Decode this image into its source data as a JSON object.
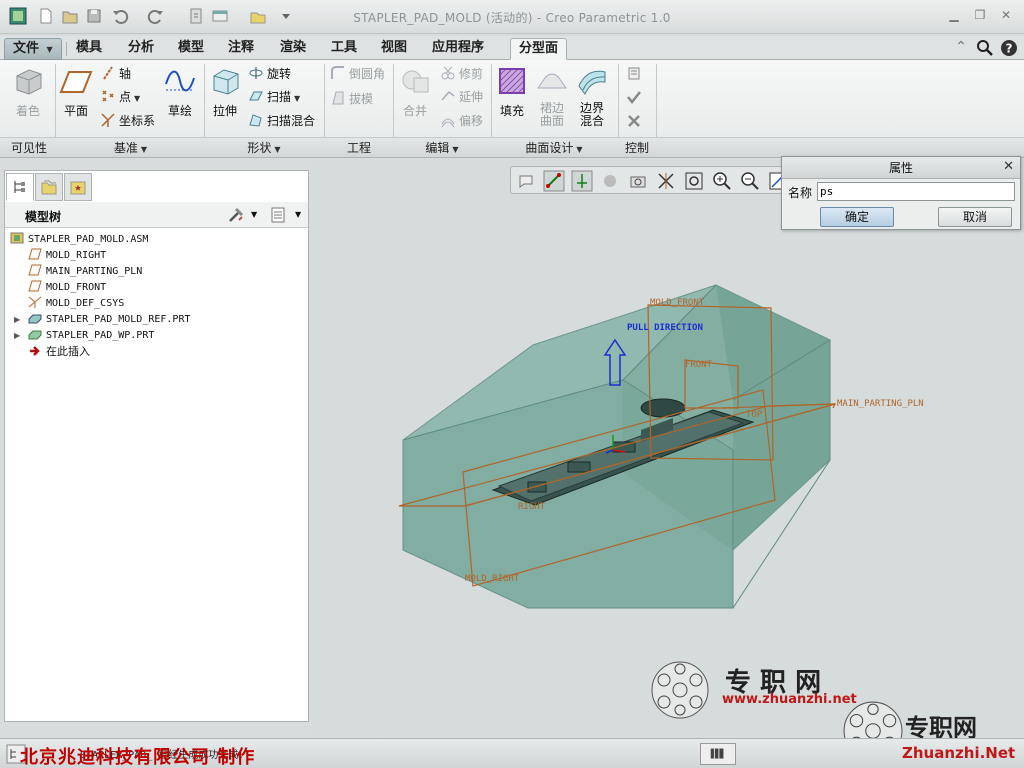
{
  "window": {
    "title": "STAPLER_PAD_MOLD (活动的) - Creo Parametric 1.0"
  },
  "tabs": [
    {
      "label": "文件",
      "name": "file"
    },
    {
      "label": "模具",
      "name": "mold"
    },
    {
      "label": "分析",
      "name": "analysis"
    },
    {
      "label": "模型",
      "name": "model"
    },
    {
      "label": "注释",
      "name": "annotate"
    },
    {
      "label": "渲染",
      "name": "render"
    },
    {
      "label": "工具",
      "name": "tools"
    },
    {
      "label": "视图",
      "name": "view"
    },
    {
      "label": "应用程序",
      "name": "applications"
    },
    {
      "label": "分型面",
      "name": "parting-surface"
    }
  ],
  "ribbon": {
    "visibility": {
      "shade": "着色",
      "group": "可见性"
    },
    "datum": {
      "plane": "平面",
      "axis": "轴",
      "point": "点",
      "csys": "坐标系",
      "sketch": "草绘",
      "group": "基准"
    },
    "shapes": {
      "extrude": "拉伸",
      "revolve": "旋转",
      "sweep": "扫描",
      "swept_blend": "扫描混合",
      "group": "形状"
    },
    "engineering": {
      "round": "倒圆角",
      "draft": "拔模",
      "group": "工程"
    },
    "editing": {
      "merge": "合并",
      "trim": "修剪",
      "extend": "延伸",
      "offset": "偏移",
      "group": "编辑"
    },
    "surface_design": {
      "fill": "填充",
      "skirt_1": "裙边",
      "skirt_2": "曲面",
      "boundary_1": "边界",
      "boundary_2": "混合",
      "group": "曲面设计"
    },
    "control": {
      "group": "控制"
    }
  },
  "model_tree": {
    "title": "模型树",
    "items": [
      {
        "label": "STAPLER_PAD_MOLD.ASM",
        "icon": "assembly-icon"
      },
      {
        "label": "MOLD_RIGHT",
        "icon": "datum-plane-icon"
      },
      {
        "label": "MAIN_PARTING_PLN",
        "icon": "datum-plane-icon"
      },
      {
        "label": "MOLD_FRONT",
        "icon": "datum-plane-icon"
      },
      {
        "label": "MOLD_DEF_CSYS",
        "icon": "csys-icon"
      },
      {
        "label": "STAPLER_PAD_MOLD_REF.PRT",
        "icon": "part-icon"
      },
      {
        "label": "STAPLER_PAD_WP.PRT",
        "icon": "part-icon"
      },
      {
        "label": "在此插入",
        "icon": "insert-here-icon"
      }
    ]
  },
  "dialog": {
    "title": "属性",
    "name_label": "名称",
    "name_value": "ps",
    "ok": "确定",
    "cancel": "取消"
  },
  "viewport_labels": {
    "mold_front": "MOLD_FRONT",
    "pull_direction": "PULL DIRECTION",
    "front": "FRONT",
    "top": "TOP",
    "main_parting_pln": "MAIN_PARTING_PLN",
    "right": "RIGHT",
    "mold_right": "MOLD_RIGHT"
  },
  "status": {
    "message": "STAPLER_PAD_ 已经生成成功完成。",
    "credit": "北京兆迪科技有限公司   制作"
  },
  "watermark": {
    "brand_cn": "专 职 网",
    "url": "www.zhuanzhi.net",
    "brand_cn_2": "专职网",
    "domain": "Zhuanzhi.Net"
  },
  "colors": {
    "mold_body": "#6f9e93",
    "datum_orange": "#b0652a",
    "pull_blue": "#1c2fd0",
    "credit_red": "#c00000"
  }
}
